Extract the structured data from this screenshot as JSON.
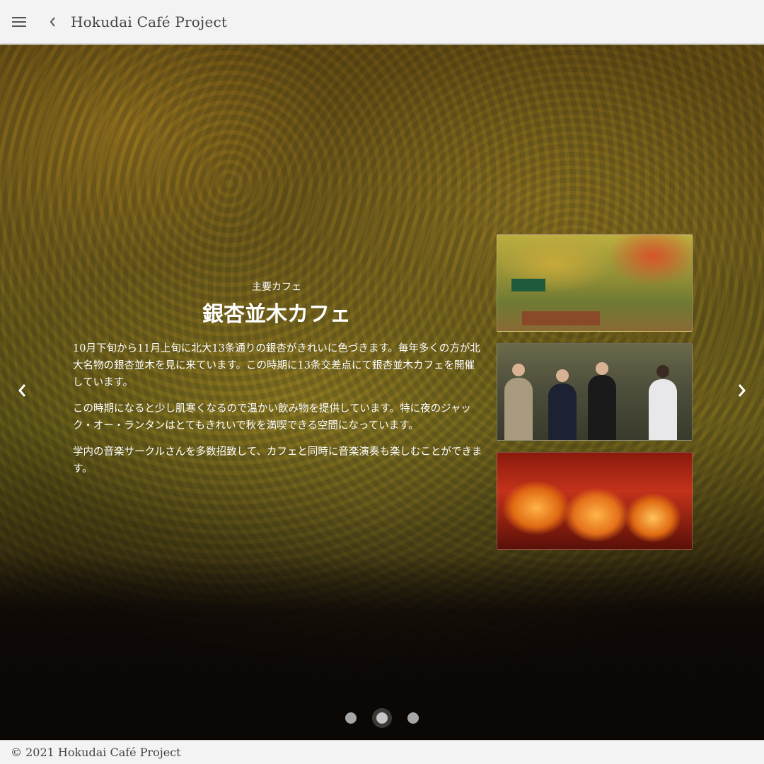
{
  "header": {
    "title": "Hokudai Café Project",
    "menu_icon": "hamburger-menu-icon",
    "back_icon": "chevron-left-icon"
  },
  "slide": {
    "subtitle": "主要カフェ",
    "title": "銀杏並木カフェ",
    "paragraphs": [
      "10月下旬から11月上旬に北大13条通りの銀杏がきれいに色づきます。毎年多くの方が北大名物の銀杏並木を見に来ています。この時期に13条交差点にて銀杏並木カフェを開催しています。",
      "この時期になると少し肌寒くなるので温かい飲み物を提供しています。特に夜のジャック・オー・ランタンはとてもきれいで秋を満喫できる空間になっています。",
      "学内の音楽サークルさんを多数招致して、カフェと同時に音楽演奏も楽しむことができます。"
    ],
    "images": [
      "cafe-tables-photo",
      "musicians-photo",
      "jack-o-lantern-photo"
    ]
  },
  "carousel": {
    "prev_icon": "chevron-left-icon",
    "next_icon": "chevron-right-icon",
    "dot_count": 3,
    "active_index": 1
  },
  "footer": {
    "copyright": "© 2021 Hokudai Café Project"
  },
  "colors": {
    "appbar_bg": "#f3f3f3",
    "text_light": "#ffffff",
    "title_text": "#444444"
  }
}
